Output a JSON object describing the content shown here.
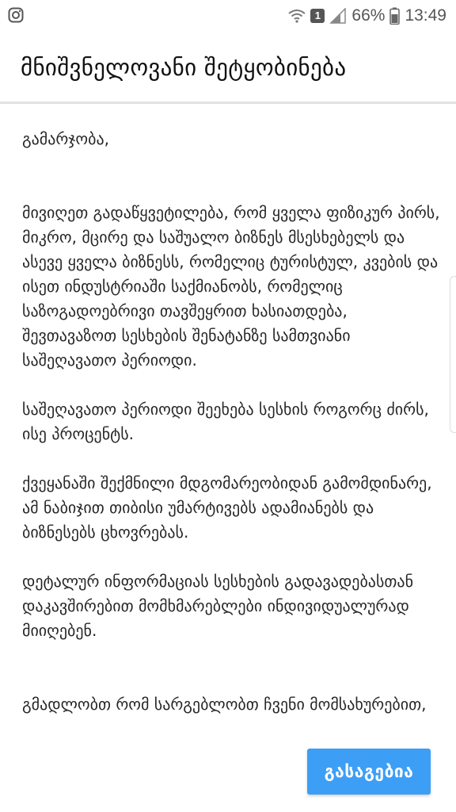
{
  "status_bar": {
    "app_icon": "instagram-icon",
    "icons": [
      "wifi-icon",
      "sim-icon",
      "signal-icon",
      "battery-icon"
    ],
    "sim_number": "1",
    "battery": "66%",
    "time": "13:49"
  },
  "dialog": {
    "title": "მნიშვნელოვანი შეტყობინება",
    "greeting": "გამარჯობა,",
    "paragraph1": "მივიღეთ გადაწყვეტილება, რომ ყველა ფიზიკურ პირს, მიკრო, მცირე და საშუალო ბიზნეს მსესხებელს და ასევე ყველა ბიზნესს, რომელიც ტურისტულ, კვების და ისეთ ინდუსტრიაში საქმიანობს, რომელიც საზოგადოებრივი თავშეყრით ხასიათდება, შევთავაზოთ სესხების შენატანზე სამთვიანი საშეღავათო პერიოდი.",
    "paragraph2": "საშეღავათო პერიოდი შეეხება სესხის როგორც ძირს, ისე პროცენტს.",
    "paragraph3": "ქვეყანაში შექმნილი მდგომარეობიდან გამომდინარე, ამ ნაბიჯით თიბისი უმარტივებს ადამიანებს და ბიზნესებს ცხოვრებას.",
    "paragraph4": "დეტალურ ინფორმაციას სესხების გადავადებასთან დაკავშირებით მომხმარებლები ინდივიდუალურად მიიღებენ.",
    "closing": "გმადლობთ რომ სარგებლობთ ჩვენი მომსახურებით,",
    "ok_button": "გასაგებია"
  },
  "colors": {
    "accent": "#3d9ef5",
    "text": "#262626",
    "divider": "#e2e2e2"
  }
}
